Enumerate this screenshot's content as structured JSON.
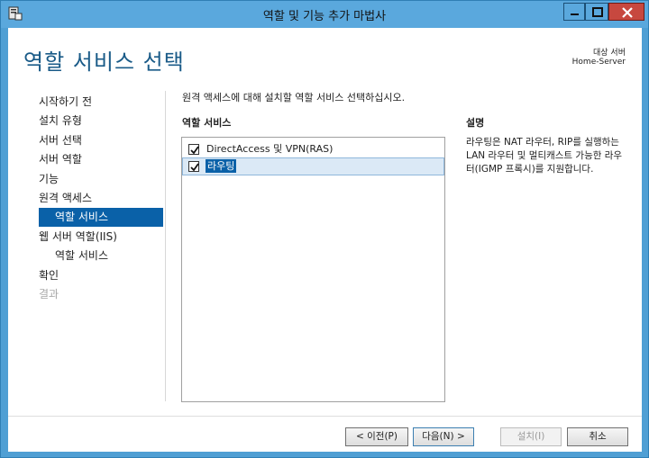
{
  "window": {
    "title": "역할 및 기능 추가 마법사"
  },
  "header": {
    "page_title": "역할 서비스 선택",
    "target_label": "대상 서버",
    "target_name": "Home-Server"
  },
  "nav": {
    "items": [
      {
        "label": "시작하기 전"
      },
      {
        "label": "설치 유형"
      },
      {
        "label": "서버 선택"
      },
      {
        "label": "서버 역할"
      },
      {
        "label": "기능"
      },
      {
        "label": "원격 액세스"
      },
      {
        "label": "역할 서비스",
        "selected": true
      },
      {
        "label": "웹 서버 역할(IIS)"
      },
      {
        "label": "역할 서비스"
      },
      {
        "label": "확인"
      },
      {
        "label": "결과",
        "disabled": true
      }
    ]
  },
  "main": {
    "instruction": "원격 액세스에 대해 설치할 역할 서비스 선택하십시오.",
    "roles_header": "역할 서비스",
    "roles": [
      {
        "label": "DirectAccess 및 VPN(RAS)",
        "checked": true
      },
      {
        "label": "라우팅",
        "checked": true,
        "selected": true
      }
    ],
    "description_header": "설명",
    "description": "라우팅은 NAT 라우터, RIP를 실행하는 LAN 라우터 및 멀티캐스트 가능한 라우터(IGMP 프록시)를 지원합니다."
  },
  "buttons": {
    "prev": "< 이전(P)",
    "next": "다음(N) >",
    "install": "설치(I)",
    "cancel": "취소"
  },
  "colors": {
    "accent": "#0a61a8",
    "title_blue": "#1a5b88",
    "frame": "#5aa8dd",
    "close": "#c7483f"
  }
}
